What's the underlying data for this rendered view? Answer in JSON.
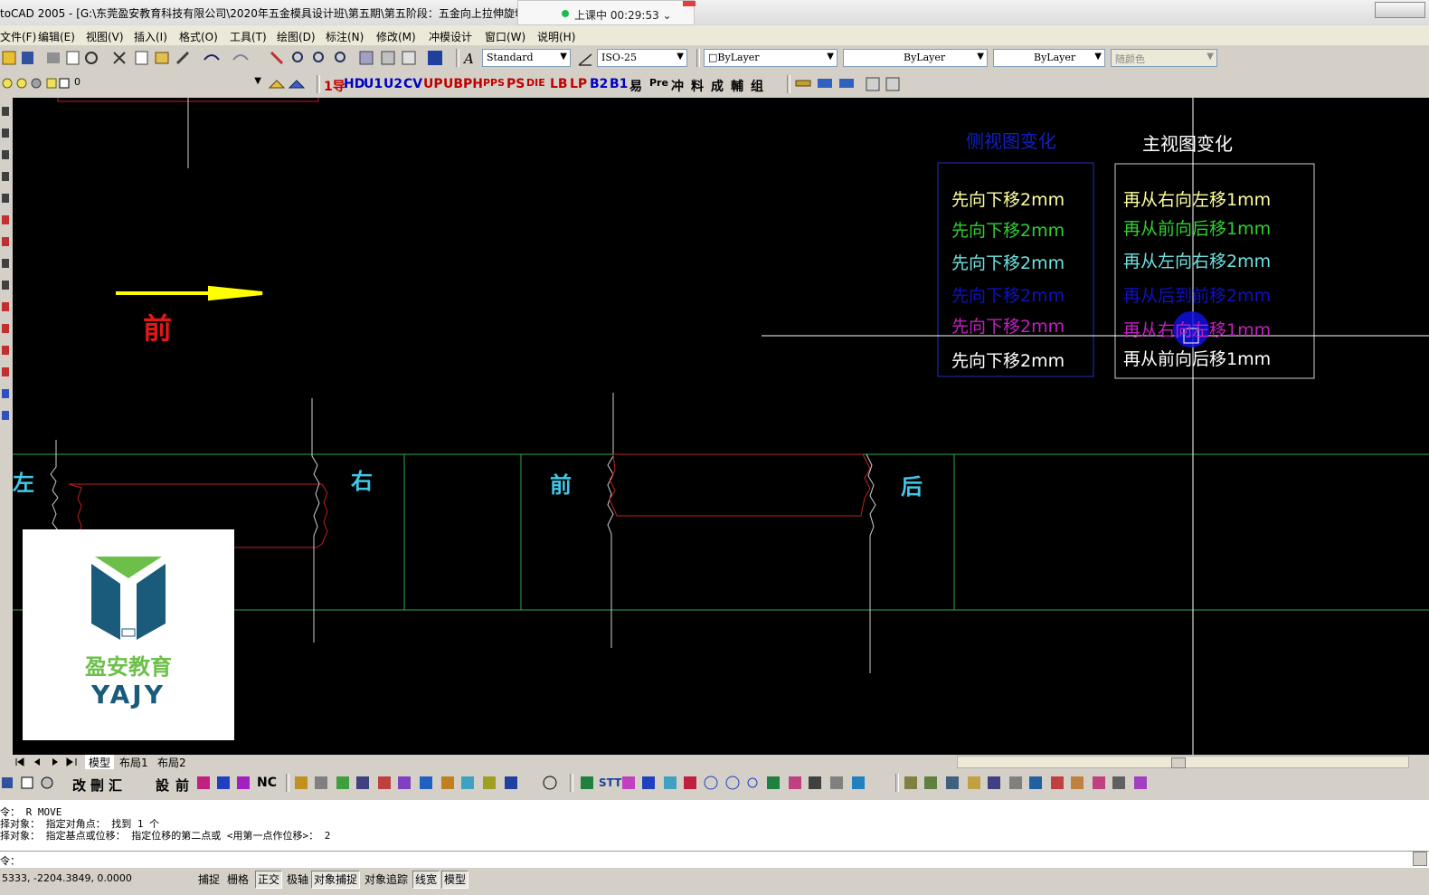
{
  "window": {
    "title": "toCAD 2005 - [G:\\东莞盈安教育科技有限公司\\2020年五金模具设计班\\第五期\\第五阶段：五金向上拉伸旋切",
    "timer_label": "上课中 00:29:53",
    "timer_chevron": "⌄"
  },
  "menu": [
    "文件(F)",
    "编辑(E)",
    "视图(V)",
    "插入(I)",
    "格式(O)",
    "工具(T)",
    "绘图(D)",
    "标注(N)",
    "修改(M)",
    "冲模设计",
    "窗口(W)",
    "说明(H)"
  ],
  "toolbar": {
    "text_style": "Standard",
    "dim_style": "ISO-25",
    "color": "ByLayer",
    "linetype": "ByLayer",
    "lineweight": "ByLayer",
    "plotstyle": "随颜色",
    "layer": "0"
  },
  "custom_toolbar": [
    {
      "label": "1导",
      "color": "#c00000"
    },
    {
      "label": "HD",
      "color": "#0000c0"
    },
    {
      "label": "U1",
      "color": "#0000c0"
    },
    {
      "label": "U2",
      "color": "#0000c0"
    },
    {
      "label": "CV",
      "color": "#0000c0"
    },
    {
      "label": "UP",
      "color": "#c00000"
    },
    {
      "label": "UB",
      "color": "#c00000"
    },
    {
      "label": "PH",
      "color": "#c00000"
    },
    {
      "label": "PPS",
      "color": "#c00000"
    },
    {
      "label": "PS",
      "color": "#c00000"
    },
    {
      "label": "DIE",
      "color": "#c00000"
    },
    {
      "label": "LB",
      "color": "#c00000"
    },
    {
      "label": "LP",
      "color": "#c00000"
    },
    {
      "label": "B2",
      "color": "#0000c0"
    },
    {
      "label": "B1",
      "color": "#0000c0"
    },
    {
      "label": "易",
      "color": "#000000"
    },
    {
      "label": "Pre",
      "color": "#000000"
    },
    {
      "label": "冲",
      "color": "#000000"
    },
    {
      "label": "料",
      "color": "#000000"
    },
    {
      "label": "成",
      "color": "#000000"
    },
    {
      "label": "輔",
      "color": "#000000"
    },
    {
      "label": "组",
      "color": "#000000"
    }
  ],
  "bottom_toolbar_text": [
    "改",
    "刪",
    "汇",
    "設",
    "前",
    "NC",
    "STT"
  ],
  "drawing": {
    "side_view_title": "侧视图变化",
    "front_view_title": "主视图变化",
    "side_steps": [
      {
        "text": "先向下移2mm",
        "color": "#ffffa0"
      },
      {
        "text": "先向下移2mm",
        "color": "#30d030"
      },
      {
        "text": "先向下移2mm",
        "color": "#70e0e0"
      },
      {
        "text": "先向下移2mm",
        "color": "#1010c0"
      },
      {
        "text": "先向下移2mm",
        "color": "#c020c0"
      },
      {
        "text": "先向下移2mm",
        "color": "#ffffff"
      }
    ],
    "front_steps": [
      {
        "text": "再从右向左移1mm",
        "color": "#ffffa0"
      },
      {
        "text": "再从前向后移1mm",
        "color": "#30d030"
      },
      {
        "text": "再从左向右移2mm",
        "color": "#70e0e0"
      },
      {
        "text": "再从后到前移2mm",
        "color": "#1010c0"
      },
      {
        "text": "再从右向左移1mm",
        "color": "#c020c0"
      },
      {
        "text": "再从前向后移1mm",
        "color": "#ffffff"
      }
    ],
    "arrow_label": "前",
    "label_left": "左",
    "label_right": "右",
    "label_front": "前",
    "label_back": "后"
  },
  "logo": {
    "name_cn": "盈安教育",
    "name_en": "YAJY"
  },
  "tabs": [
    "模型",
    "布局1",
    "布局2"
  ],
  "command_history": [
    "令： R MOVE",
    "择对象： 指定对角点： 找到 1 个",
    "择对象：  指定基点或位移： 指定位移的第二点或 <用第一点作位移>： 2"
  ],
  "command_prompt": "令：",
  "status": {
    "coords": "5333, -2204.3849, 0.0000",
    "buttons": [
      {
        "label": "捕捉",
        "on": false
      },
      {
        "label": "栅格",
        "on": false
      },
      {
        "label": "正交",
        "on": true
      },
      {
        "label": "极轴",
        "on": false
      },
      {
        "label": "对象捕捉",
        "on": true
      },
      {
        "label": "对象追踪",
        "on": false
      },
      {
        "label": "线宽",
        "on": true
      },
      {
        "label": "模型",
        "on": true
      }
    ]
  }
}
